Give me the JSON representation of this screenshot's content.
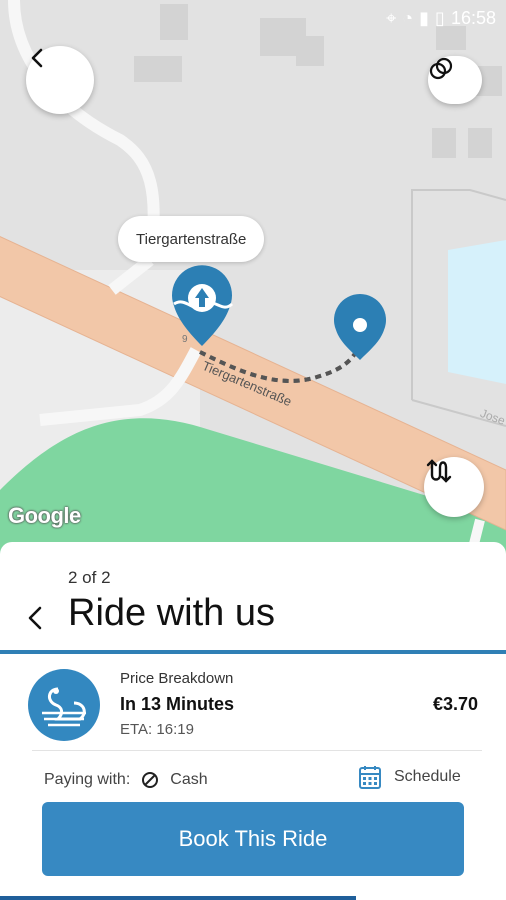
{
  "status_bar": {
    "time": "16:58"
  },
  "map": {
    "street_label": "Tiergartenstraße",
    "street_name_on_map": "Tiergartenstraße",
    "house_number": "9",
    "map_attribution": "Google",
    "partial_street": "Jose"
  },
  "sheet": {
    "step": "2 of 2",
    "title": "Ride with us",
    "price_breakdown": "Price Breakdown",
    "minutes": "In 13 Minutes",
    "eta": "ETA: 16:19",
    "price": "€3.70",
    "paying_label": "Paying with:",
    "payment_method": "Cash",
    "schedule_label": "Schedule",
    "book_button": "Book This Ride"
  },
  "colors": {
    "accent": "#3789c2",
    "road": "#f2c7a8",
    "park": "#7fd6a0",
    "water": "#d6f1fb"
  }
}
